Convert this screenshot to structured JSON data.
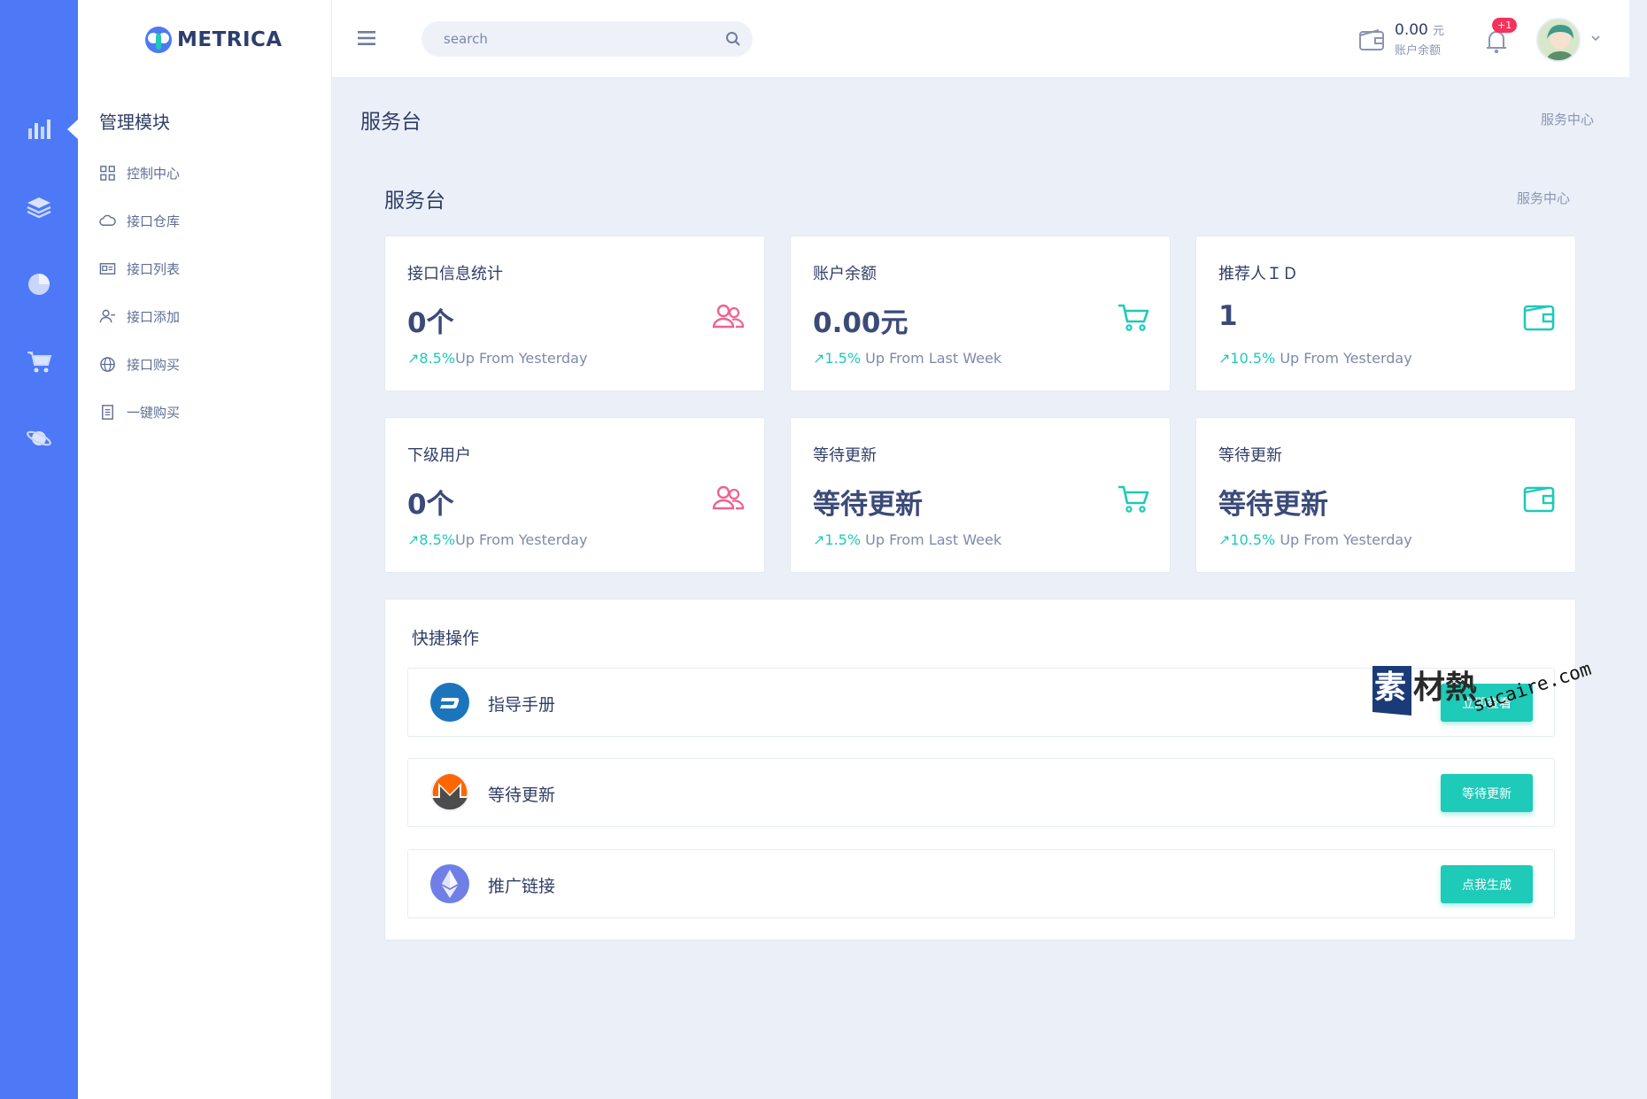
{
  "brand": {
    "name": "METRICA",
    "accent": "#4d79f6"
  },
  "rail": {
    "icons": [
      "bar-chart-icon",
      "layers-icon",
      "pie-chart-icon",
      "cart-icon",
      "planet-icon"
    ]
  },
  "sidebar": {
    "module_title": "管理模块",
    "items": [
      {
        "label": "控制中心",
        "icon": "grid-icon"
      },
      {
        "label": "接口仓库",
        "icon": "cloud-icon"
      },
      {
        "label": "接口列表",
        "icon": "id-card-icon"
      },
      {
        "label": "接口添加",
        "icon": "user-add-icon"
      },
      {
        "label": "接口购买",
        "icon": "globe-icon"
      },
      {
        "label": "一键购买",
        "icon": "document-icon"
      }
    ]
  },
  "topbar": {
    "search_placeholder": "search",
    "balance_amount": "0.00",
    "balance_unit": "元",
    "balance_label": "账户余额",
    "notification_badge": "+1"
  },
  "page": {
    "title": "服务台",
    "breadcrumb": "服务中心",
    "section_title": "服务台",
    "section_breadcrumb": "服务中心"
  },
  "cards": [
    {
      "title": "接口信息统计",
      "value": "0个",
      "trend_value": "8.5%",
      "trend_text": "Up From Yesterday",
      "icon": "users-icon",
      "color": "#f06292"
    },
    {
      "title": "账户余额",
      "value": "0.00元",
      "trend_value": "1.5%",
      "trend_text": " Up From Last Week",
      "icon": "cart-icon",
      "color": "#1ecab8"
    },
    {
      "title": "推荐人ＩＤ",
      "value": "1",
      "trend_value": "10.5%",
      "trend_text": " Up From Yesterday",
      "icon": "wallet-icon",
      "color": "#1ecab8"
    },
    {
      "title": "下级用户",
      "value": "0个",
      "trend_value": "8.5%",
      "trend_text": "Up From Yesterday",
      "icon": "users-icon",
      "color": "#f06292"
    },
    {
      "title": "等待更新",
      "value": "等待更新",
      "trend_value": "1.5%",
      "trend_text": " Up From Last Week",
      "icon": "cart-icon",
      "color": "#1ecab8"
    },
    {
      "title": "等待更新",
      "value": "等待更新",
      "trend_value": "10.5%",
      "trend_text": " Up From Yesterday",
      "icon": "wallet-icon",
      "color": "#1ecab8"
    }
  ],
  "quick": {
    "title": "快捷操作",
    "rows": [
      {
        "label": "指导手册",
        "button": "立即查看",
        "icon": "dash-coin-icon"
      },
      {
        "label": "等待更新",
        "button": "等待更新",
        "icon": "monero-coin-icon"
      },
      {
        "label": "推广链接",
        "button": "点我生成",
        "icon": "ethereum-coin-icon"
      }
    ]
  },
  "watermark": {
    "text_cn": "素材熱",
    "text_en": "sucaire.com"
  }
}
